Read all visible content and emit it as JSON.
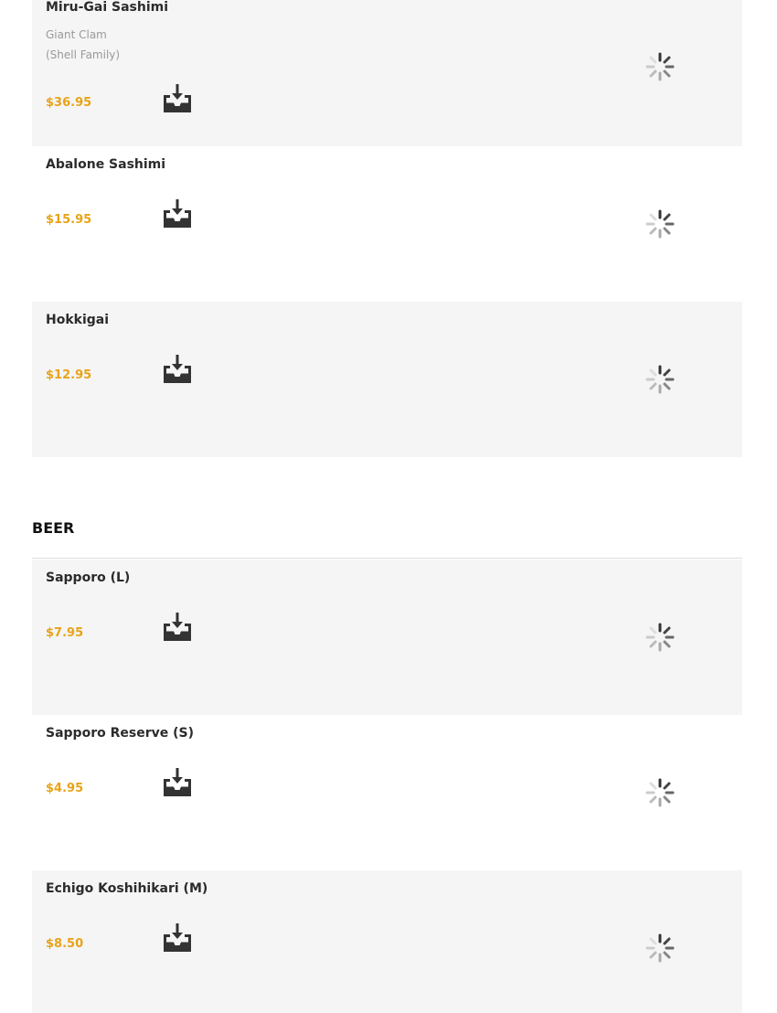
{
  "items_top": [
    {
      "name": "Miru-Gai Sashimi",
      "desc_line1": "Giant Clam",
      "desc_line2": "(Shell Family)",
      "price": "$36.95"
    },
    {
      "name": "Abalone Sashimi",
      "price": "$15.95"
    },
    {
      "name": "Hokkigai",
      "price": "$12.95"
    }
  ],
  "beer_section": {
    "title": "BEER",
    "items": [
      {
        "name": "Sapporo (L)",
        "price": "$7.95"
      },
      {
        "name": "Sapporo Reserve (S)",
        "price": "$4.95"
      },
      {
        "name": "Echigo Koshihikari (M)",
        "price": "$8.50"
      }
    ]
  },
  "colors": {
    "price": "#e8a317",
    "card_shade": "#f5f5f5",
    "text": "#2b2b2b"
  },
  "icons": {
    "add": "add-to-cart-icon",
    "image": "loading-spinner-icon"
  }
}
